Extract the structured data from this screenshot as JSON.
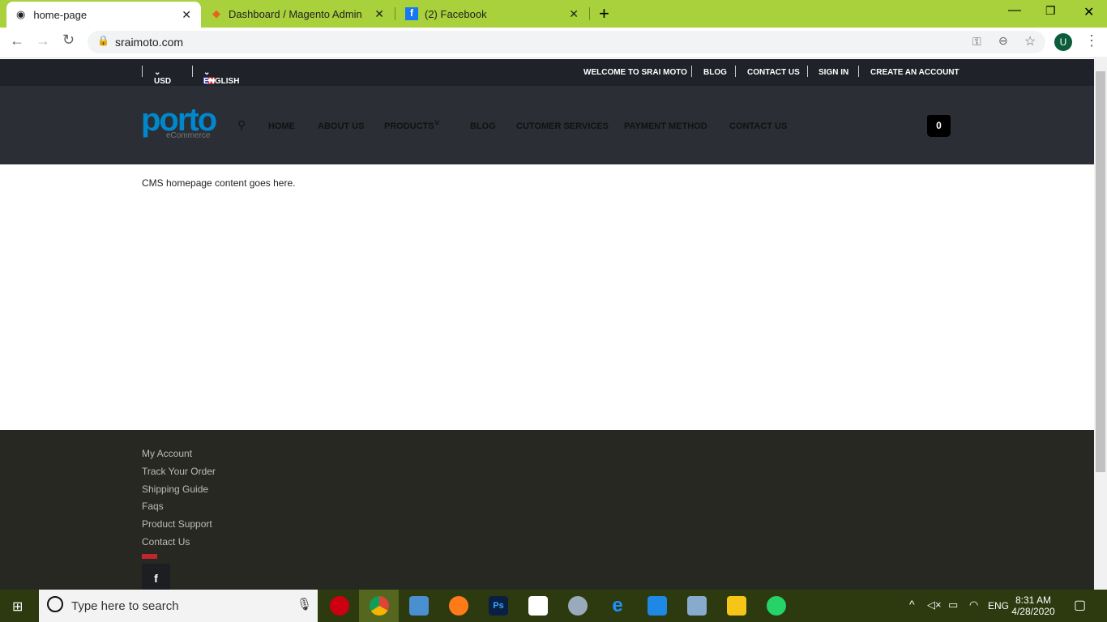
{
  "browser": {
    "tabs": [
      {
        "title": "home-page",
        "active": true
      },
      {
        "title": "Dashboard / Magento Admin"
      },
      {
        "title": "(2) Facebook"
      }
    ],
    "url": "sraimoto.com",
    "profile_initial": "U"
  },
  "topbar": {
    "currency": "USD",
    "language": "ENGLISH",
    "links": [
      "WELCOME TO SRAI MOTO",
      "BLOG",
      "CONTACT US",
      "SIGN IN",
      "CREATE AN ACCOUNT"
    ]
  },
  "header": {
    "logo": "porto",
    "logo_sub": "eCommerce",
    "nav": [
      "HOME",
      "ABOUT US",
      "PRODUCTS",
      "BLOG",
      "CUTOMER SERVICES",
      "PAYMENT METHOD",
      "CONTACT US"
    ],
    "cart_count": "0"
  },
  "main": {
    "content": "CMS homepage content goes here."
  },
  "footer": {
    "links": [
      "My Account",
      "Track Your Order",
      "Shipping Guide",
      "Faqs",
      "Product Support",
      "Contact Us"
    ],
    "social": "f"
  },
  "taskbar": {
    "search_placeholder": "Type here to search",
    "lang": "ENG",
    "time": "8:31 AM",
    "date": "4/28/2020"
  },
  "colors": {
    "chrome_frame": "#a8d13c",
    "logo": "#0088cc",
    "header": "#2b2e34",
    "footer": "#272822"
  }
}
